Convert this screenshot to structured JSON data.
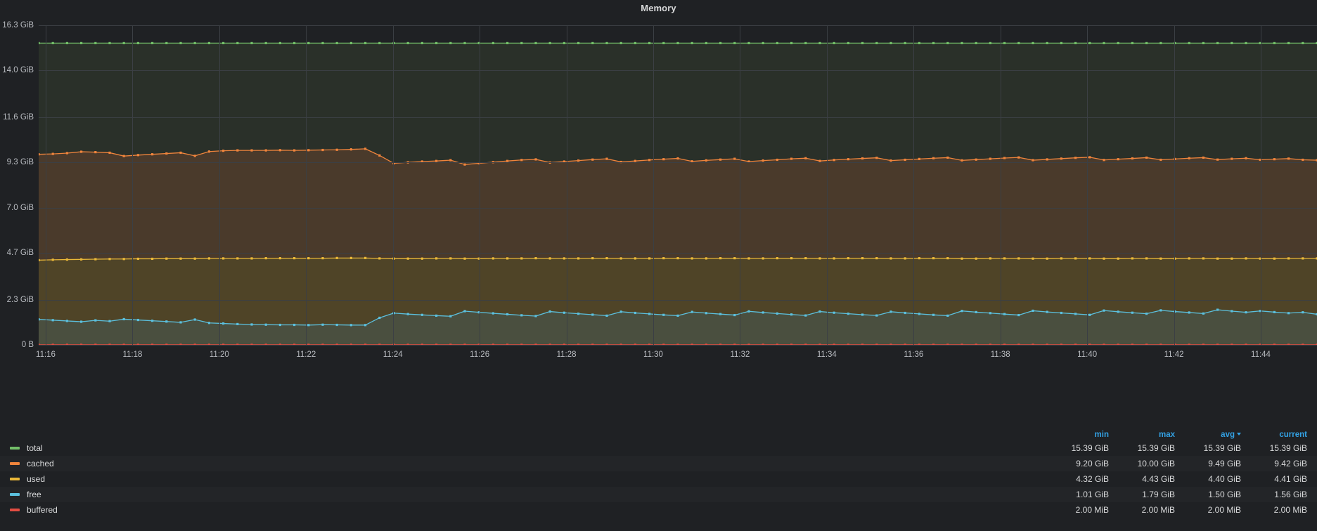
{
  "panel": {
    "title": "Memory",
    "theme": "grafana-dark",
    "background": "#1f2124"
  },
  "chart_data": {
    "type": "area",
    "title": "Memory",
    "xlabel": "",
    "ylabel": "",
    "grid": true,
    "legend_position": "bottom-table",
    "x_tick_labels": [
      "11:16",
      "11:18",
      "11:20",
      "11:22",
      "11:24",
      "11:26",
      "11:28",
      "11:30",
      "11:32",
      "11:34",
      "11:36",
      "11:38",
      "11:40",
      "11:42",
      "11:44"
    ],
    "y_tick_labels": [
      "0 B",
      "2.3 GiB",
      "4.7 GiB",
      "7.0 GiB",
      "9.3 GiB",
      "11.6 GiB",
      "14.0 GiB",
      "16.3 GiB"
    ],
    "y_tick_values": [
      0,
      2.3,
      4.7,
      7.0,
      9.3,
      11.6,
      14.0,
      16.3
    ],
    "ylim": [
      0,
      16.3
    ],
    "xlim": [
      "11:15",
      "11:45"
    ],
    "unit": "GiB",
    "series": [
      {
        "name": "total",
        "color": "#73bf69",
        "fill": "#2a3029",
        "min": "15.39 GiB",
        "max": "15.39 GiB",
        "avg": "15.39 GiB",
        "current": "15.39 GiB",
        "values": [
          15.39,
          15.39,
          15.39,
          15.39,
          15.39,
          15.39,
          15.39,
          15.39,
          15.39,
          15.39,
          15.39,
          15.39,
          15.39,
          15.39,
          15.39,
          15.39,
          15.39,
          15.39,
          15.39,
          15.39,
          15.39,
          15.39,
          15.39,
          15.39,
          15.39,
          15.39,
          15.39,
          15.39,
          15.39,
          15.39,
          15.39,
          15.39,
          15.39,
          15.39,
          15.39,
          15.39,
          15.39,
          15.39,
          15.39,
          15.39,
          15.39,
          15.39,
          15.39,
          15.39,
          15.39,
          15.39,
          15.39,
          15.39,
          15.39,
          15.39,
          15.39,
          15.39,
          15.39,
          15.39,
          15.39,
          15.39,
          15.39,
          15.39,
          15.39,
          15.39,
          15.39,
          15.39,
          15.39,
          15.39,
          15.39,
          15.39,
          15.39,
          15.39,
          15.39,
          15.39,
          15.39,
          15.39,
          15.39,
          15.39,
          15.39,
          15.39,
          15.39,
          15.39,
          15.39,
          15.39,
          15.39,
          15.39,
          15.39,
          15.39,
          15.39,
          15.39,
          15.39,
          15.39,
          15.39,
          15.39,
          15.39
        ]
      },
      {
        "name": "cached",
        "color": "#ef843c",
        "fill": "#4a3a2b",
        "min": "9.20 GiB",
        "max": "10.00 GiB",
        "avg": "9.49 GiB",
        "current": "9.42 GiB",
        "values": [
          9.72,
          9.74,
          9.78,
          9.85,
          9.83,
          9.8,
          9.63,
          9.68,
          9.72,
          9.76,
          9.8,
          9.64,
          9.86,
          9.9,
          9.92,
          9.92,
          9.92,
          9.93,
          9.92,
          9.93,
          9.94,
          9.95,
          9.97,
          10.0,
          9.66,
          9.26,
          9.31,
          9.35,
          9.38,
          9.42,
          9.2,
          9.26,
          9.32,
          9.38,
          9.43,
          9.46,
          9.3,
          9.35,
          9.4,
          9.45,
          9.49,
          9.33,
          9.38,
          9.43,
          9.47,
          9.51,
          9.36,
          9.41,
          9.45,
          9.49,
          9.35,
          9.4,
          9.44,
          9.49,
          9.52,
          9.38,
          9.43,
          9.47,
          9.51,
          9.54,
          9.4,
          9.44,
          9.48,
          9.52,
          9.55,
          9.41,
          9.45,
          9.49,
          9.53,
          9.56,
          9.42,
          9.46,
          9.5,
          9.54,
          9.57,
          9.43,
          9.47,
          9.51,
          9.55,
          9.44,
          9.48,
          9.52,
          9.55,
          9.45,
          9.49,
          9.52,
          9.44,
          9.47,
          9.5,
          9.44,
          9.42
        ]
      },
      {
        "name": "used",
        "color": "#eab839",
        "fill": "#4f4427",
        "min": "4.32 GiB",
        "max": "4.43 GiB",
        "avg": "4.40 GiB",
        "current": "4.41 GiB",
        "values": [
          4.32,
          4.34,
          4.35,
          4.36,
          4.37,
          4.38,
          4.38,
          4.39,
          4.39,
          4.4,
          4.4,
          4.4,
          4.41,
          4.41,
          4.41,
          4.41,
          4.42,
          4.42,
          4.42,
          4.42,
          4.42,
          4.43,
          4.43,
          4.43,
          4.41,
          4.4,
          4.4,
          4.4,
          4.41,
          4.41,
          4.4,
          4.4,
          4.41,
          4.41,
          4.41,
          4.42,
          4.41,
          4.41,
          4.41,
          4.42,
          4.42,
          4.41,
          4.41,
          4.41,
          4.42,
          4.42,
          4.41,
          4.41,
          4.42,
          4.42,
          4.41,
          4.41,
          4.42,
          4.42,
          4.42,
          4.41,
          4.41,
          4.42,
          4.42,
          4.42,
          4.41,
          4.41,
          4.42,
          4.42,
          4.42,
          4.4,
          4.4,
          4.41,
          4.41,
          4.41,
          4.4,
          4.4,
          4.41,
          4.41,
          4.41,
          4.4,
          4.4,
          4.41,
          4.41,
          4.4,
          4.4,
          4.41,
          4.41,
          4.4,
          4.4,
          4.41,
          4.4,
          4.4,
          4.41,
          4.41,
          4.41
        ]
      },
      {
        "name": "free",
        "color": "#5bc0de",
        "fill": "#4a4f3f",
        "min": "1.01 GiB",
        "max": "1.79 GiB",
        "avg": "1.50 GiB",
        "current": "1.56 GiB",
        "values": [
          1.3,
          1.26,
          1.22,
          1.18,
          1.25,
          1.21,
          1.31,
          1.27,
          1.23,
          1.19,
          1.15,
          1.29,
          1.12,
          1.09,
          1.06,
          1.04,
          1.03,
          1.02,
          1.02,
          1.01,
          1.03,
          1.02,
          1.01,
          1.01,
          1.38,
          1.62,
          1.57,
          1.53,
          1.49,
          1.46,
          1.72,
          1.66,
          1.61,
          1.56,
          1.51,
          1.47,
          1.7,
          1.64,
          1.59,
          1.54,
          1.49,
          1.69,
          1.63,
          1.58,
          1.53,
          1.49,
          1.68,
          1.62,
          1.57,
          1.52,
          1.71,
          1.65,
          1.6,
          1.55,
          1.5,
          1.7,
          1.64,
          1.59,
          1.54,
          1.5,
          1.69,
          1.63,
          1.58,
          1.53,
          1.49,
          1.73,
          1.67,
          1.62,
          1.57,
          1.52,
          1.74,
          1.68,
          1.63,
          1.58,
          1.53,
          1.75,
          1.69,
          1.64,
          1.59,
          1.76,
          1.7,
          1.65,
          1.6,
          1.79,
          1.72,
          1.66,
          1.73,
          1.67,
          1.62,
          1.66,
          1.56
        ]
      },
      {
        "name": "buffered",
        "color": "#e24d42",
        "fill": "#33272b",
        "min": "2.00 MiB",
        "max": "2.00 MiB",
        "avg": "2.00 MiB",
        "current": "2.00 MiB",
        "values": [
          0.00195,
          0.00195,
          0.00195,
          0.00195,
          0.00195,
          0.00195,
          0.00195,
          0.00195,
          0.00195,
          0.00195,
          0.00195,
          0.00195,
          0.00195,
          0.00195,
          0.00195,
          0.00195,
          0.00195,
          0.00195,
          0.00195,
          0.00195,
          0.00195,
          0.00195,
          0.00195,
          0.00195,
          0.00195,
          0.00195,
          0.00195,
          0.00195,
          0.00195,
          0.00195,
          0.00195,
          0.00195,
          0.00195,
          0.00195,
          0.00195,
          0.00195,
          0.00195,
          0.00195,
          0.00195,
          0.00195,
          0.00195,
          0.00195,
          0.00195,
          0.00195,
          0.00195,
          0.00195,
          0.00195,
          0.00195,
          0.00195,
          0.00195,
          0.00195,
          0.00195,
          0.00195,
          0.00195,
          0.00195,
          0.00195,
          0.00195,
          0.00195,
          0.00195,
          0.00195,
          0.00195,
          0.00195,
          0.00195,
          0.00195,
          0.00195,
          0.00195,
          0.00195,
          0.00195,
          0.00195,
          0.00195,
          0.00195,
          0.00195,
          0.00195,
          0.00195,
          0.00195,
          0.00195,
          0.00195,
          0.00195,
          0.00195,
          0.00195,
          0.00195,
          0.00195,
          0.00195,
          0.00195,
          0.00195,
          0.00195,
          0.00195,
          0.00195,
          0.00195,
          0.00195,
          0.00195
        ]
      }
    ]
  },
  "legend": {
    "columns": [
      "min",
      "max",
      "avg",
      "current"
    ],
    "sorted_by": "avg",
    "sort_direction": "desc",
    "rows": [
      {
        "name": "total",
        "color": "#73bf69",
        "min": "15.39 GiB",
        "max": "15.39 GiB",
        "avg": "15.39 GiB",
        "current": "15.39 GiB"
      },
      {
        "name": "cached",
        "color": "#ef843c",
        "min": "9.20 GiB",
        "max": "10.00 GiB",
        "avg": "9.49 GiB",
        "current": "9.42 GiB"
      },
      {
        "name": "used",
        "color": "#eab839",
        "min": "4.32 GiB",
        "max": "4.43 GiB",
        "avg": "4.40 GiB",
        "current": "4.41 GiB"
      },
      {
        "name": "free",
        "color": "#5bc0de",
        "min": "1.01 GiB",
        "max": "1.79 GiB",
        "avg": "1.50 GiB",
        "current": "1.56 GiB"
      },
      {
        "name": "buffered",
        "color": "#e24d42",
        "min": "2.00 MiB",
        "max": "2.00 MiB",
        "avg": "2.00 MiB",
        "current": "2.00 MiB"
      }
    ]
  }
}
